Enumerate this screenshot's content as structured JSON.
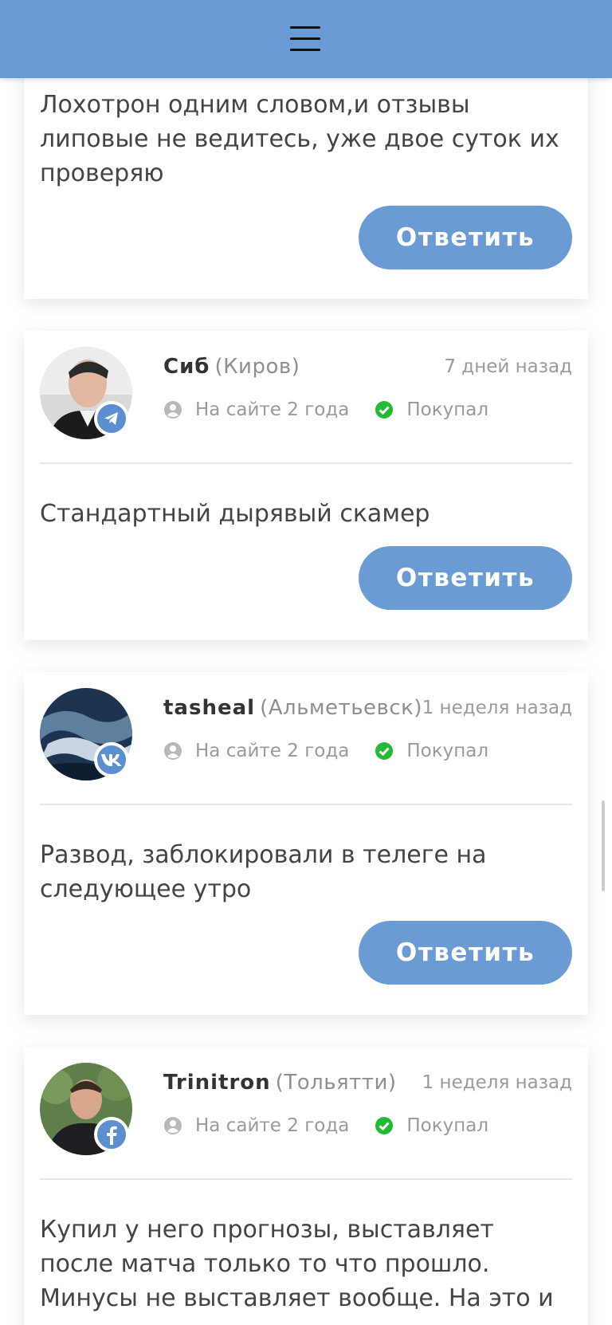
{
  "header": {
    "bg_color": "#6a9bd4",
    "menu_icon": "hamburger-menu-icon"
  },
  "reply_label": "Ответить",
  "comments": [
    {
      "text": "Лохотрон одним словом,и отзывы липовые не ведитесь, уже двое суток их проверяю"
    },
    {
      "name": "Сиб",
      "city": "(Киров)",
      "date": "7 дней назад",
      "on_site": "На сайте 2 года",
      "status": "Покупал",
      "social": "telegram-icon",
      "text": "Стандартный дырявый скамер"
    },
    {
      "name": "tasheal",
      "city": "(Альметьевск)",
      "date": "1 неделя назад",
      "on_site": "На сайте 2 года",
      "status": "Покупал",
      "social": "vk-icon",
      "text": "Развод, заблокировали в телеге на следующее утро"
    },
    {
      "name": "Trinitron",
      "city": "(Тольятти)",
      "date": "1 неделя назад",
      "on_site": "На сайте 2 года",
      "status": "Покупал",
      "social": "facebook-icon",
      "text": "Купил у него прогнозы, выставляет после матча только то что прошло. Минусы не выставляет вообще. На это и повелся"
    }
  ],
  "colors": {
    "accent": "#6a9bd4",
    "check_green": "#22bb33",
    "muted_text": "#9a9a9a"
  }
}
